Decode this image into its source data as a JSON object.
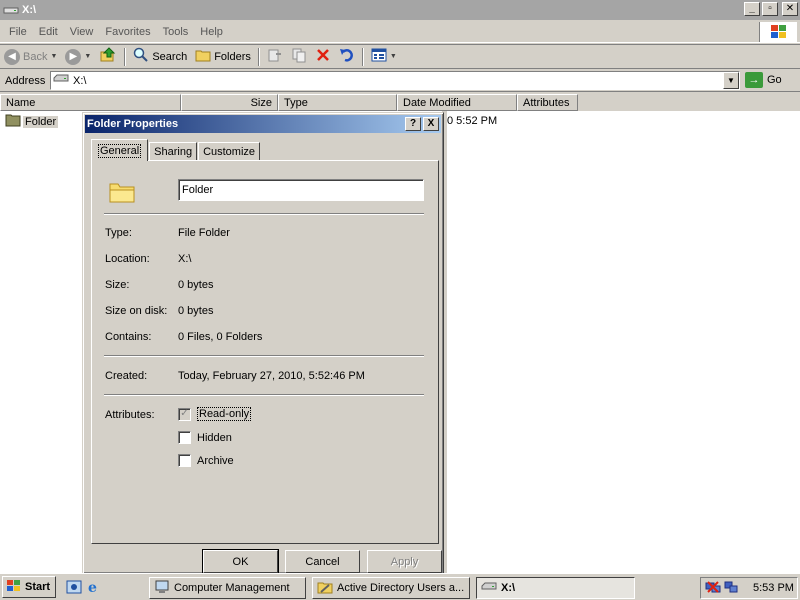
{
  "window": {
    "title": "X:\\"
  },
  "menu": [
    "File",
    "Edit",
    "View",
    "Favorites",
    "Tools",
    "Help"
  ],
  "toolbar": {
    "back": "Back",
    "search": "Search",
    "folders": "Folders"
  },
  "address": {
    "label": "Address",
    "value": "X:\\",
    "go": "Go"
  },
  "columns": [
    "Name",
    "Size",
    "Type",
    "Date Modified",
    "Attributes"
  ],
  "tree": {
    "item": "Folder"
  },
  "list": {
    "partial_text": "0 5:52 PM"
  },
  "dialog": {
    "title": "Folder Properties",
    "help_btn": "?",
    "close_btn": "X",
    "tabs": [
      "General",
      "Sharing",
      "Customize"
    ],
    "name_value": "Folder",
    "props": [
      {
        "label": "Type:",
        "value": "File Folder"
      },
      {
        "label": "Location:",
        "value": "X:\\"
      },
      {
        "label": "Size:",
        "value": "0 bytes"
      },
      {
        "label": "Size on disk:",
        "value": "0 bytes"
      },
      {
        "label": "Contains:",
        "value": "0 Files, 0 Folders"
      }
    ],
    "created": {
      "label": "Created:",
      "value": "Today, February 27, 2010, 5:52:46 PM"
    },
    "attributes": {
      "label": "Attributes:",
      "readonly": {
        "label": "Read-only",
        "checked": true
      },
      "hidden": {
        "label": "Hidden",
        "checked": false
      },
      "archive": {
        "label": "Archive",
        "checked": false
      }
    },
    "buttons": {
      "ok": "OK",
      "cancel": "Cancel",
      "apply": "Apply"
    }
  },
  "taskbar": {
    "start": "Start",
    "tasks": [
      "Computer Management",
      "Active Directory Users a...",
      "X:\\"
    ],
    "clock": "5:53 PM"
  },
  "colors": {
    "dialog_title_start": "#0a246a",
    "dialog_title_end": "#a6caf0",
    "face": "#d4d0c8"
  }
}
